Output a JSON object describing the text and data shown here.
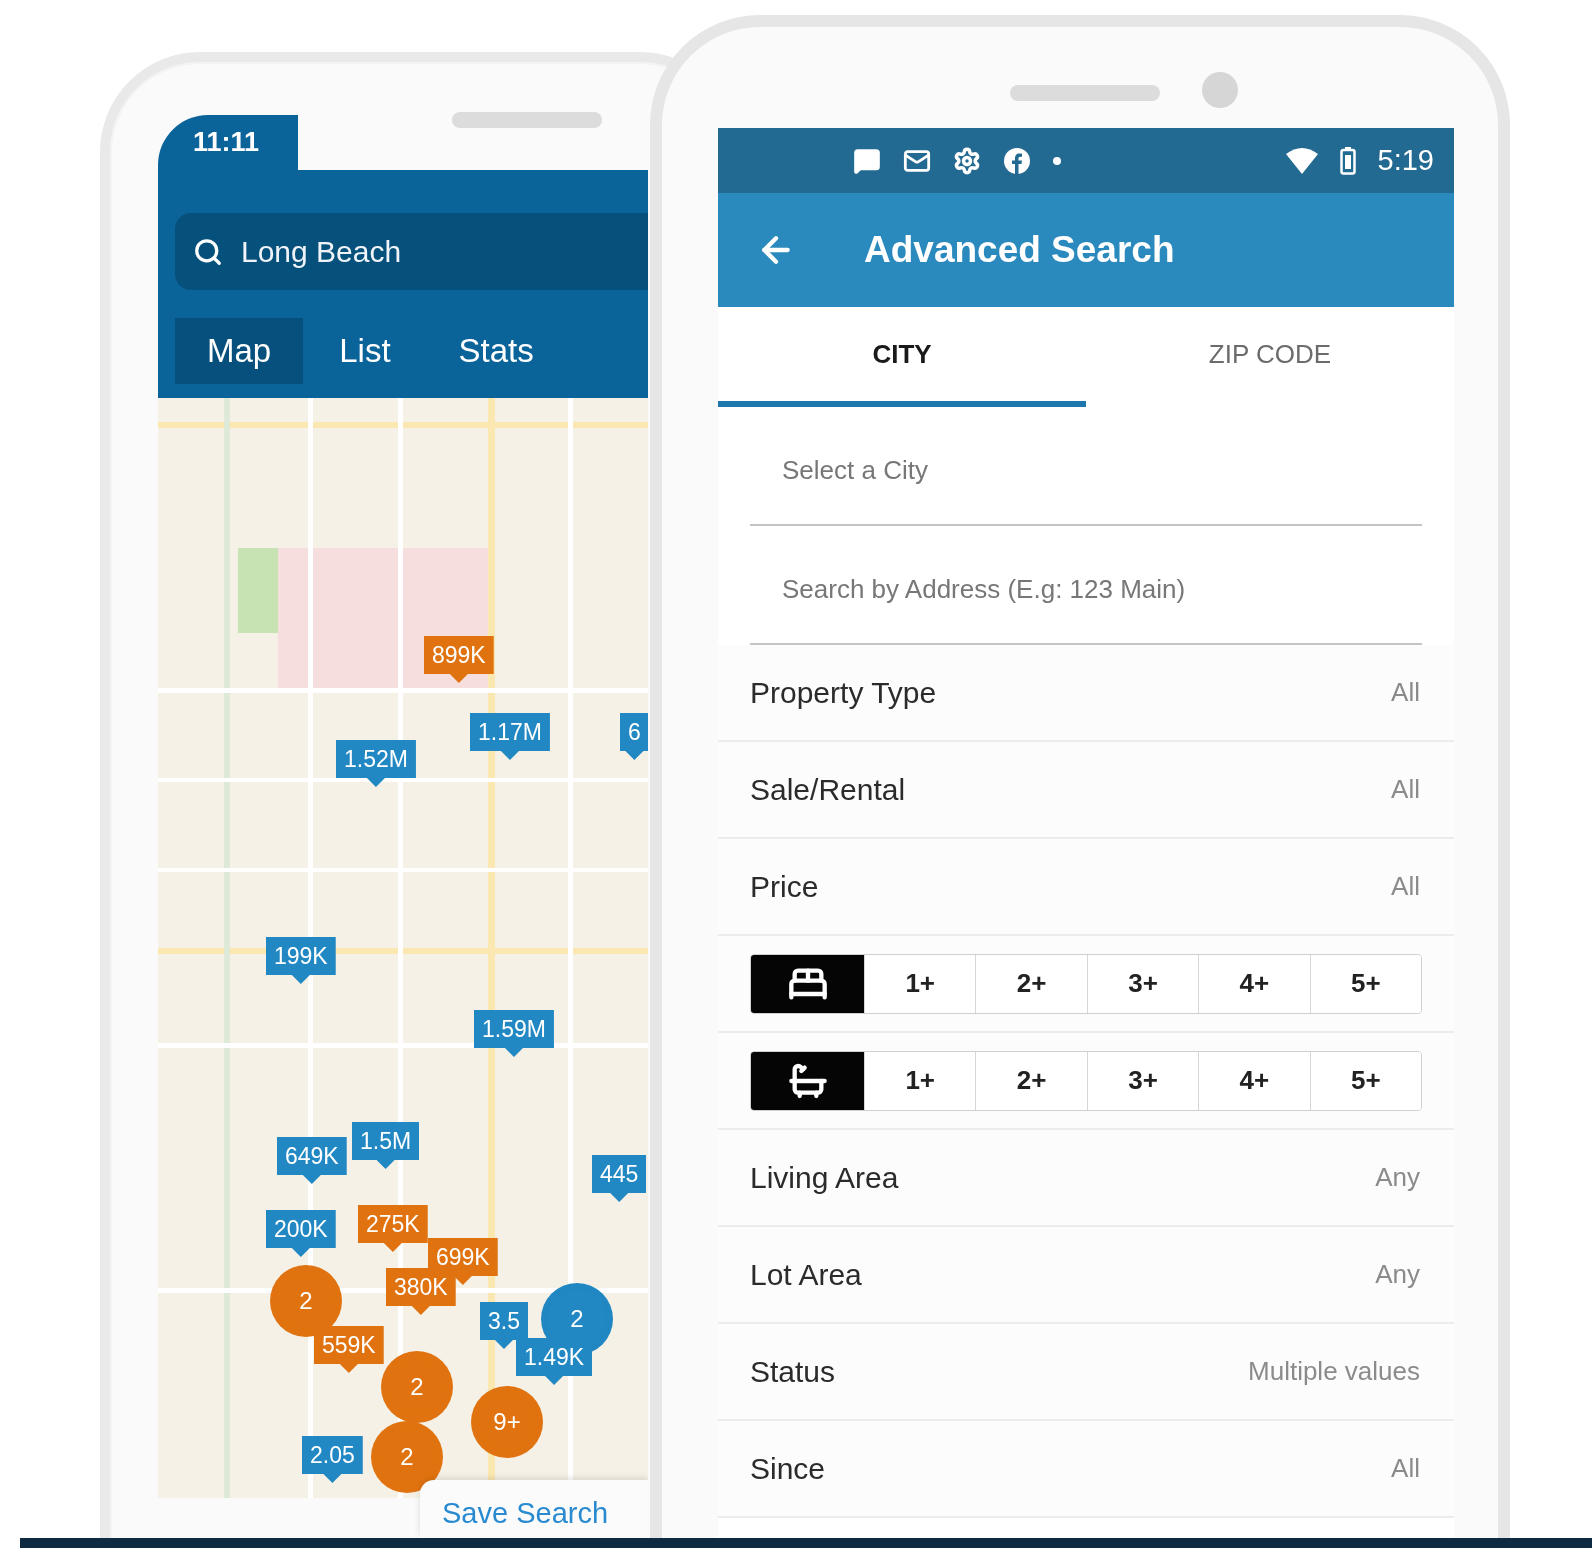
{
  "map_phone": {
    "status_time": "11:11",
    "search": {
      "value": "Long Beach"
    },
    "tabs": [
      {
        "label": "Map",
        "selected": true
      },
      {
        "label": "List",
        "selected": false
      },
      {
        "label": "Stats",
        "selected": false
      }
    ],
    "map": {
      "pins": [
        {
          "kind": "tag",
          "label": "899K",
          "color": "#e0730f"
        },
        {
          "kind": "tag",
          "label": "1.17M",
          "color": "#2188c3"
        },
        {
          "kind": "tag",
          "label": "1.52M",
          "color": "#2188c3"
        },
        {
          "kind": "tag",
          "label": "6",
          "color": "#2188c3"
        },
        {
          "kind": "tag",
          "label": "199K",
          "color": "#2188c3"
        },
        {
          "kind": "tag",
          "label": "1.59M",
          "color": "#2188c3"
        },
        {
          "kind": "tag",
          "label": "1.5M",
          "color": "#2188c3"
        },
        {
          "kind": "tag",
          "label": "649K",
          "color": "#2188c3"
        },
        {
          "kind": "tag",
          "label": "445",
          "color": "#2188c3"
        },
        {
          "kind": "tag",
          "label": "275K",
          "color": "#e0730f"
        },
        {
          "kind": "tag",
          "label": "200K",
          "color": "#2188c3"
        },
        {
          "kind": "tag",
          "label": "699K",
          "color": "#e0730f"
        },
        {
          "kind": "tag",
          "label": "380K",
          "color": "#e0730f"
        },
        {
          "kind": "cluster",
          "label": "2",
          "color": "#e0730f"
        },
        {
          "kind": "tag",
          "label": "3.5",
          "color": "#2188c3"
        },
        {
          "kind": "cluster",
          "label": "2",
          "color": "#2188c3"
        },
        {
          "kind": "tag",
          "label": "1.49K",
          "color": "#2188c3"
        },
        {
          "kind": "tag",
          "label": "559K",
          "color": "#e0730f"
        },
        {
          "kind": "cluster",
          "label": "2",
          "color": "#e0730f"
        },
        {
          "kind": "cluster",
          "label": "9+",
          "color": "#e0730f"
        },
        {
          "kind": "tag",
          "label": "2.05",
          "color": "#2188c3"
        },
        {
          "kind": "cluster",
          "label": "2",
          "color": "#e0730f"
        }
      ]
    },
    "save_button": "Save Search"
  },
  "search_phone": {
    "status_bar": {
      "time": "5:19"
    },
    "title": "Advanced Search",
    "tabs": [
      {
        "label": "CITY",
        "selected": true
      },
      {
        "label": "ZIP CODE",
        "selected": false
      }
    ],
    "fields": [
      {
        "placeholder": "Select a City"
      },
      {
        "placeholder": "Search by Address (E.g: 123 Main)"
      }
    ],
    "rows": [
      {
        "kind": "setting",
        "label": "Property Type",
        "value": "All"
      },
      {
        "kind": "setting",
        "label": "Sale/Rental",
        "value": "All"
      },
      {
        "kind": "setting",
        "label": "Price",
        "value": "All"
      },
      {
        "kind": "beds",
        "options": [
          {
            "label": "1+",
            "selected": false
          },
          {
            "label": "2+",
            "selected": false
          },
          {
            "label": "3+",
            "selected": false
          },
          {
            "label": "4+",
            "selected": false
          },
          {
            "label": "5+",
            "selected": false
          }
        ]
      },
      {
        "kind": "baths",
        "options": [
          {
            "label": "1+",
            "selected": false
          },
          {
            "label": "2+",
            "selected": false
          },
          {
            "label": "3+",
            "selected": false
          },
          {
            "label": "4+",
            "selected": false
          },
          {
            "label": "5+",
            "selected": false
          }
        ]
      },
      {
        "kind": "setting",
        "label": "Living Area",
        "value": "Any"
      },
      {
        "kind": "setting",
        "label": "Lot Area",
        "value": "Any"
      },
      {
        "kind": "setting",
        "label": "Status",
        "value": "Multiple values"
      },
      {
        "kind": "setting",
        "label": "Since",
        "value": "All"
      }
    ]
  }
}
